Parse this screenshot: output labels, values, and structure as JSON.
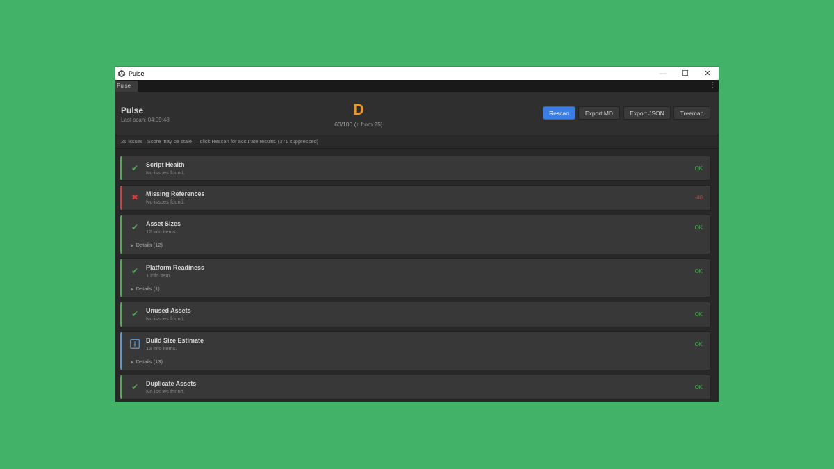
{
  "window": {
    "title": "Pulse",
    "tab": "Pulse",
    "menu_icon": "kebab-menu-icon",
    "controls": {
      "minimize": "—",
      "maximize": "☐",
      "close": "✕"
    }
  },
  "header": {
    "title": "Pulse",
    "last_scan": "Last scan: 04:09:48",
    "grade": "D",
    "score": "60/100 (↑ from 25)",
    "buttons": {
      "rescan": "Rescan",
      "export_md": "Export MD",
      "export_json": "Export JSON",
      "treemap": "Treemap"
    }
  },
  "status": "26 issues | Score may be stale — click Rescan for accurate results. (371 suppressed)",
  "colors": {
    "ok": "#4caf50",
    "error": "#d83b3b",
    "info": "#5b9bd5",
    "grade": "#f0961e",
    "primary": "#3b7de6"
  },
  "cards": [
    {
      "name": "Script Health",
      "subtitle": "No issues found.",
      "status": "OK",
      "icon": "check-icon"
    },
    {
      "name": "Missing References",
      "subtitle": "No issues found.",
      "status": "-40",
      "icon": "x-icon"
    },
    {
      "name": "Asset Sizes",
      "subtitle": "12 info items.",
      "status": "OK",
      "icon": "check-icon",
      "details": "Details (12)"
    },
    {
      "name": "Platform Readiness",
      "subtitle": "1 info item.",
      "status": "OK",
      "icon": "check-icon",
      "details": "Details (1)"
    },
    {
      "name": "Unused Assets",
      "subtitle": "No issues found.",
      "status": "OK",
      "icon": "check-icon"
    },
    {
      "name": "Build Size Estimate",
      "subtitle": "13 info items.",
      "status": "OK",
      "icon": "info-icon",
      "details": "Details (13)"
    },
    {
      "name": "Duplicate Assets",
      "subtitle": "No issues found.",
      "status": "OK",
      "icon": "check-icon"
    }
  ]
}
